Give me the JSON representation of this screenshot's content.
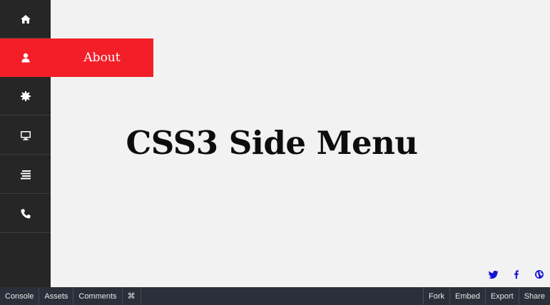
{
  "sidebar": {
    "items": [
      {
        "icon": "home-icon",
        "label": "",
        "active": false
      },
      {
        "icon": "user-icon",
        "label": "About",
        "active": true
      },
      {
        "icon": "gear-icon",
        "label": "",
        "active": false
      },
      {
        "icon": "monitor-icon",
        "label": "",
        "active": false
      },
      {
        "icon": "list-icon",
        "label": "",
        "active": false
      },
      {
        "icon": "phone-icon",
        "label": "",
        "active": false
      }
    ]
  },
  "main": {
    "title": "CSS3 Side Menu"
  },
  "social": [
    {
      "icon": "twitter-icon",
      "color": "#1515d6"
    },
    {
      "icon": "facebook-icon",
      "color": "#1515d6"
    },
    {
      "icon": "globe-icon",
      "color": "#1515d6"
    }
  ],
  "bottombar": {
    "left": [
      "Console",
      "Assets",
      "Comments",
      "⌘"
    ],
    "right": [
      "Fork",
      "Embed",
      "Export",
      "Share"
    ]
  },
  "colors": {
    "active": "#f21f29",
    "sidebar": "#262626",
    "background": "#f2f2f2"
  }
}
